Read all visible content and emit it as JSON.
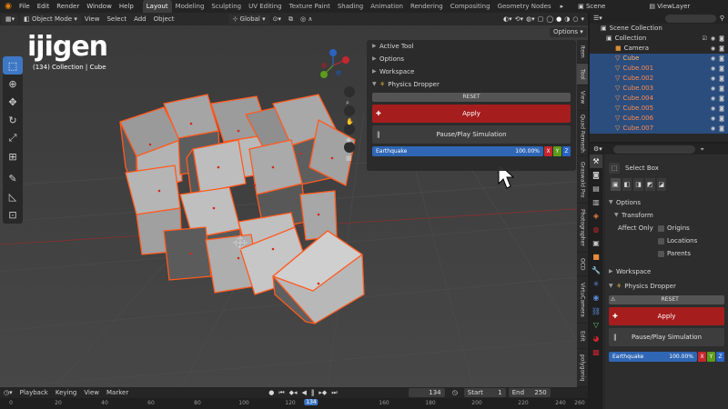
{
  "topbar": {
    "menus": [
      "File",
      "Edit",
      "Render",
      "Window",
      "Help"
    ],
    "workspaces": [
      "Layout",
      "Modeling",
      "Sculpting",
      "UV Editing",
      "Texture Paint",
      "Shading",
      "Animation",
      "Rendering",
      "Compositing",
      "Geometry Nodes"
    ],
    "active_workspace": "Layout",
    "scene_label": "Scene",
    "view_layer": "ViewLayer"
  },
  "viewport": {
    "mode": "Object Mode",
    "menus": [
      "View",
      "Select",
      "Add",
      "Object"
    ],
    "transform_orientation": "Global",
    "options_label": "Options",
    "overlay_text": "(134) Collection | Cube",
    "watermark": "ijigen"
  },
  "npanel": {
    "sections": [
      "Active Tool",
      "Options",
      "Workspace"
    ],
    "addon_title": "Physics Dropper",
    "reset_label": "RESET",
    "apply_label": "Apply",
    "pause_label": "Pause/Play Simulation",
    "slider_label": "Earthquake",
    "slider_value": "100.00%",
    "slider_fraction": 1.0,
    "axes": [
      "X",
      "Y",
      "Z"
    ]
  },
  "vtabs": [
    "Item",
    "Tool",
    "View",
    "Quad Remesh",
    "Graswald Pro",
    "Photographer",
    "OCD",
    "VirtuCamera",
    "Edit",
    "polygoniq"
  ],
  "outliner": {
    "title": "Scene Collection",
    "collection": "Collection",
    "objects": [
      "Camera",
      "Cube",
      "Cube.001",
      "Cube.002",
      "Cube.003",
      "Cube.004",
      "Cube.005",
      "Cube.006",
      "Cube.007"
    ]
  },
  "properties": {
    "tool_name": "Select Box",
    "options_label": "Options",
    "transform_label": "Transform",
    "affect_only_label": "Affect Only",
    "affect_options": [
      "Origins",
      "Locations",
      "Parents"
    ],
    "workspace_label": "Workspace",
    "addon_title": "Physics Dropper",
    "reset_label": "RESET",
    "apply_label": "Apply",
    "pause_label": "Pause/Play Simulation",
    "slider_label": "Earthquake",
    "slider_value": "100.00%",
    "axes": [
      "X",
      "Y",
      "Z"
    ]
  },
  "timeline": {
    "menus": [
      "Playback",
      "Keying",
      "View",
      "Marker"
    ],
    "current_frame": "134",
    "start_label": "Start",
    "start_value": "1",
    "end_label": "End",
    "end_value": "250",
    "ticks": [
      "0",
      "20",
      "40",
      "60",
      "80",
      "100",
      "120",
      "134",
      "160",
      "180",
      "200",
      "220",
      "240",
      "260"
    ]
  },
  "colors": {
    "accent": "#3e78c4",
    "apply_red": "#a61d1d",
    "slider_blue": "#2f67b5",
    "selection_outline": "#ff5a1f",
    "axis_x": "#c6262e",
    "axis_y": "#5c9b1c",
    "axis_z": "#2a63c4"
  }
}
